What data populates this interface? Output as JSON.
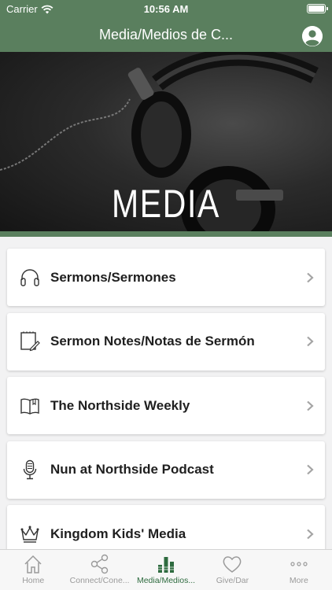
{
  "status": {
    "carrier": "Carrier",
    "time": "10:56 AM"
  },
  "nav": {
    "title": "Media/Medios de C..."
  },
  "hero": {
    "title": "MEDIA"
  },
  "items": [
    {
      "label": "Sermons/Sermones",
      "icon": "headphones-icon"
    },
    {
      "label": "Sermon Notes/Notas de Sermón",
      "icon": "notepad-icon"
    },
    {
      "label": "The Northside Weekly",
      "icon": "book-icon"
    },
    {
      "label": "Nun at Northside Podcast",
      "icon": "microphone-icon"
    },
    {
      "label": "Kingdom Kids' Media",
      "icon": "crown-icon"
    }
  ],
  "tabs": [
    {
      "label": "Home",
      "icon": "home-icon"
    },
    {
      "label": "Connect/Cone...",
      "icon": "share-icon"
    },
    {
      "label": "Media/Medios...",
      "icon": "equalizer-icon"
    },
    {
      "label": "Give/Dar",
      "icon": "heart-icon"
    },
    {
      "label": "More",
      "icon": "more-icon"
    }
  ],
  "colors": {
    "brand": "#5a7f5e",
    "active_tab": "#2e6b3f",
    "inactive_tab": "#9a9a9a"
  }
}
